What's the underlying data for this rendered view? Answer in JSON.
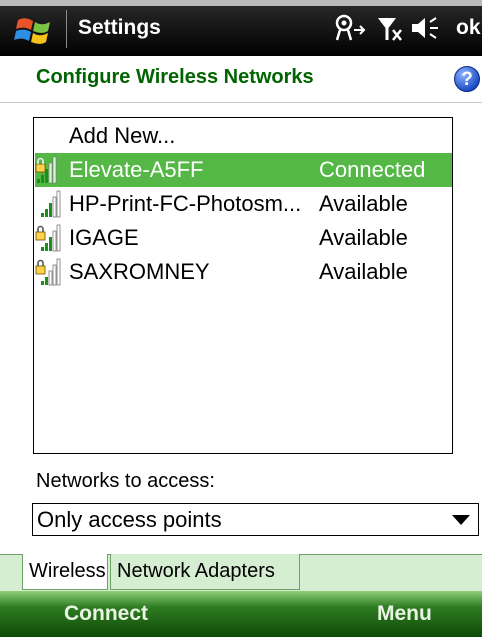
{
  "titlebar": {
    "title": "Settings",
    "ok_label": "ok",
    "icons": [
      "windows-start-icon",
      "connectivity-icon",
      "no-signal-icon",
      "speaker-icon"
    ]
  },
  "header": {
    "title": "Configure Wireless Networks",
    "help_icon": "help-icon",
    "help_glyph": "?"
  },
  "networks": {
    "add_new": "Add New...",
    "items": [
      {
        "name": "Elevate-A5FF",
        "status": "Connected",
        "secured": true,
        "selected": true
      },
      {
        "name": "HP-Print-FC-Photosm...",
        "status": "Available",
        "secured": false,
        "selected": false
      },
      {
        "name": "IGAGE",
        "status": "Available",
        "secured": true,
        "selected": false
      },
      {
        "name": "SAXROMNEY",
        "status": "Available",
        "secured": true,
        "selected": false
      }
    ]
  },
  "access": {
    "label": "Networks to access:",
    "selected": "Only access points"
  },
  "tabs": [
    {
      "label": "Wireless",
      "active": true
    },
    {
      "label": "Network Adapters",
      "active": false
    }
  ],
  "softkeys": {
    "left": "Connect",
    "right": "Menu"
  },
  "colors": {
    "title_green": "#006400",
    "selection_green": "#54b746",
    "softkey_green": "#2f7c22"
  }
}
